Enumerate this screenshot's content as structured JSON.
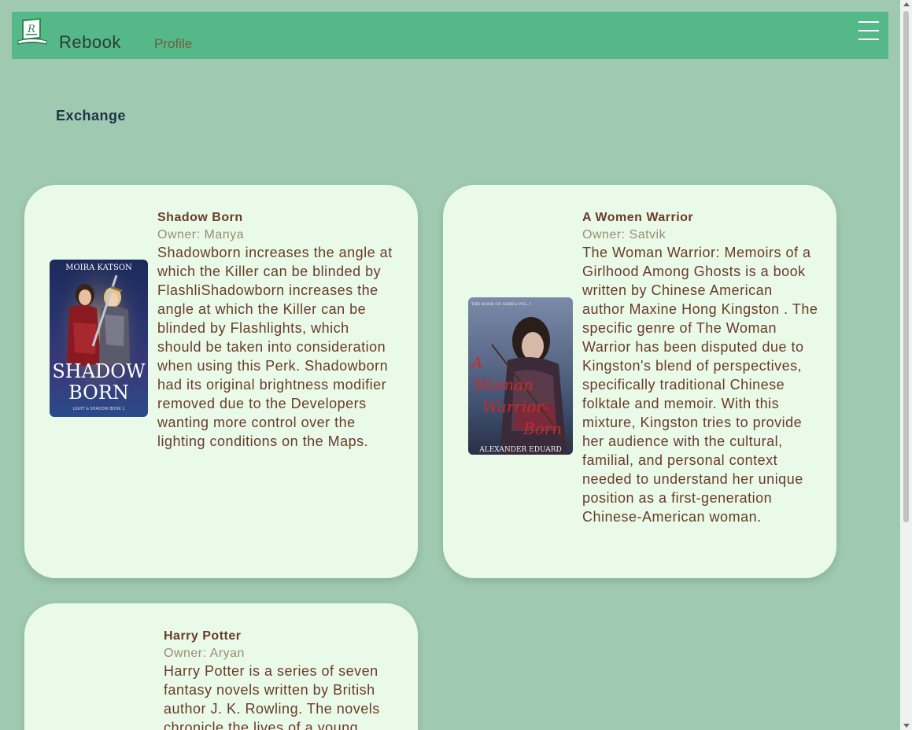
{
  "navbar": {
    "brand": "Rebook",
    "logo_letter": "R",
    "links": [
      {
        "label": "Profile"
      }
    ],
    "menu_icon": "hamburger-icon"
  },
  "section": {
    "title": "Exchange"
  },
  "owner_prefix": "Owner: ",
  "books": [
    {
      "title": "Shadow Born",
      "owner": "Manya",
      "description": "Shadowborn increases the angle at which the Killer can be blinded by FlashliShadowborn increases the angle at which the Killer can be blinded by Flashlights, which should be taken into consideration when using this Perk. Shadowborn had its original brightness modifier removed due to the Developers wanting more control over the lighting conditions on the Maps.",
      "cover": {
        "author": "MOIRA KATSON",
        "title_line1": "SHADOW",
        "title_line2": "BORN",
        "series": "LIGHT & SHADOW BOOK 1"
      }
    },
    {
      "title": "A Women Warrior",
      "owner": "Satvik",
      "description": "The Woman Warrior: Memoirs of a Girlhood Among Ghosts is a book written by Chinese American author Maxine Hong Kingston . The specific genre of The Woman Warrior has been disputed due to Kingston's blend of perspectives, specifically traditional Chinese folktale and memoir. With this mixture, Kingston tries to provide her audience with the cultural, familial, and personal context needed to understand her unique position as a first-generation Chinese-American woman.",
      "cover": {
        "series": "THE BOOK OF AGREA VOL. I",
        "title_line1": "A",
        "title_line2": "Woman",
        "title_line3": "Warrior-",
        "title_line4": "Born",
        "author": "ALEXANDER EDUARD"
      }
    },
    {
      "title": "Harry Potter",
      "owner": "Aryan",
      "description": "Harry Potter is a series of seven fantasy novels written by British author J. K. Rowling. The novels chronicle the lives of a young"
    }
  ],
  "colors": {
    "background": "#9fc9b0",
    "navbar": "#55b889",
    "card": "#e9fbe8",
    "text_primary": "#6a3a2a"
  }
}
